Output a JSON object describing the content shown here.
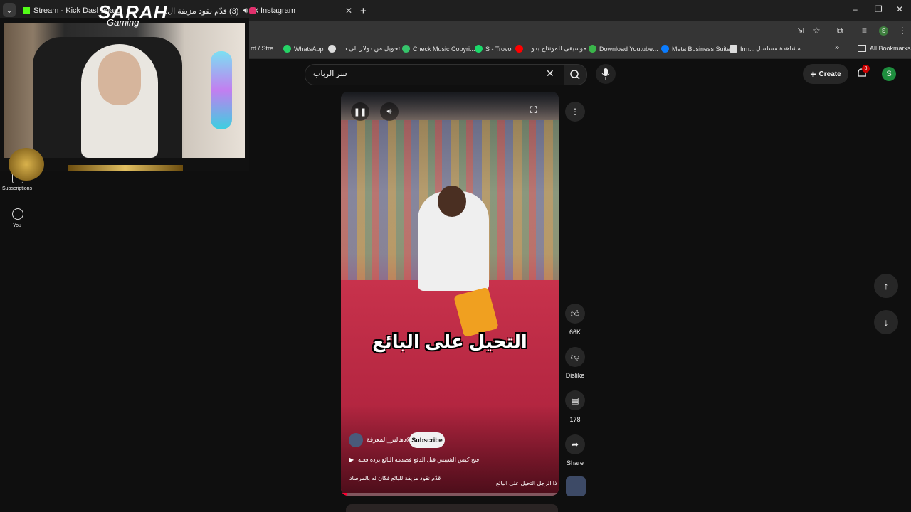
{
  "browser": {
    "tabs": [
      {
        "label": "Stream - Kick Dashboard",
        "favicon_color": "#53fc18"
      },
      {
        "label": "(3) قدّم نقود مزيفة ال...",
        "favicon_color": "#ff0000"
      },
      {
        "label": "Instagram",
        "favicon_color": "#e1306c"
      }
    ],
    "new_tab": "+",
    "window_controls": {
      "minimize": "–",
      "restore": "❐",
      "close": "✕"
    },
    "bookmarks": [
      {
        "label": "rd / Stre...",
        "color": "#888888"
      },
      {
        "label": "WhatsApp",
        "color": "#25d366"
      },
      {
        "label": "تحويل من دولار الى د...",
        "color": "#dddddd"
      },
      {
        "label": "Check Music Copyri...",
        "color": "#36c46b"
      },
      {
        "label": "S - Trovo",
        "color": "#1bd96a"
      },
      {
        "label": "موسيقى للمونتاج بدو...",
        "color": "#ff0000"
      },
      {
        "label": "Download Youtube...",
        "color": "#3ab54a"
      },
      {
        "label": "Meta Business Suite",
        "color": "#0a7cff"
      },
      {
        "label": "Irm...",
        "color": "#dddddd"
      },
      {
        "label": "مشاهدة مسلسل",
        "color": "#dddddd"
      }
    ],
    "bookmarks_overflow": "»",
    "all_bookmarks": "All Bookmarks"
  },
  "overlay": {
    "brand": "SARAH",
    "brand_sub": "Gaming"
  },
  "youtube": {
    "search_value": "سر الزباب",
    "create_label": "Create",
    "notification_count": "3",
    "avatar_letter": "S",
    "sidebar": [
      {
        "label": "Subscriptions",
        "icon": "subscriptions-icon"
      },
      {
        "label": "You",
        "icon": "you-icon"
      }
    ],
    "short": {
      "caption": "التحيل على البائع",
      "channel": "@دهاليز_المعرفة",
      "subscribe_label": "Subscribe",
      "description": "افتح كيس الشيبس قبل الدفع فصدمه البائع برده فعله",
      "ticker_a": "قدّم نقود مزيفة للبائع فكان له بالمرصاد",
      "ticker_b": "ذا الرجل التحيل على البائع",
      "progress": 0.03
    },
    "actions": {
      "likes": "66K",
      "dislike": "Dislike",
      "comments": "178",
      "share": "Share"
    }
  }
}
